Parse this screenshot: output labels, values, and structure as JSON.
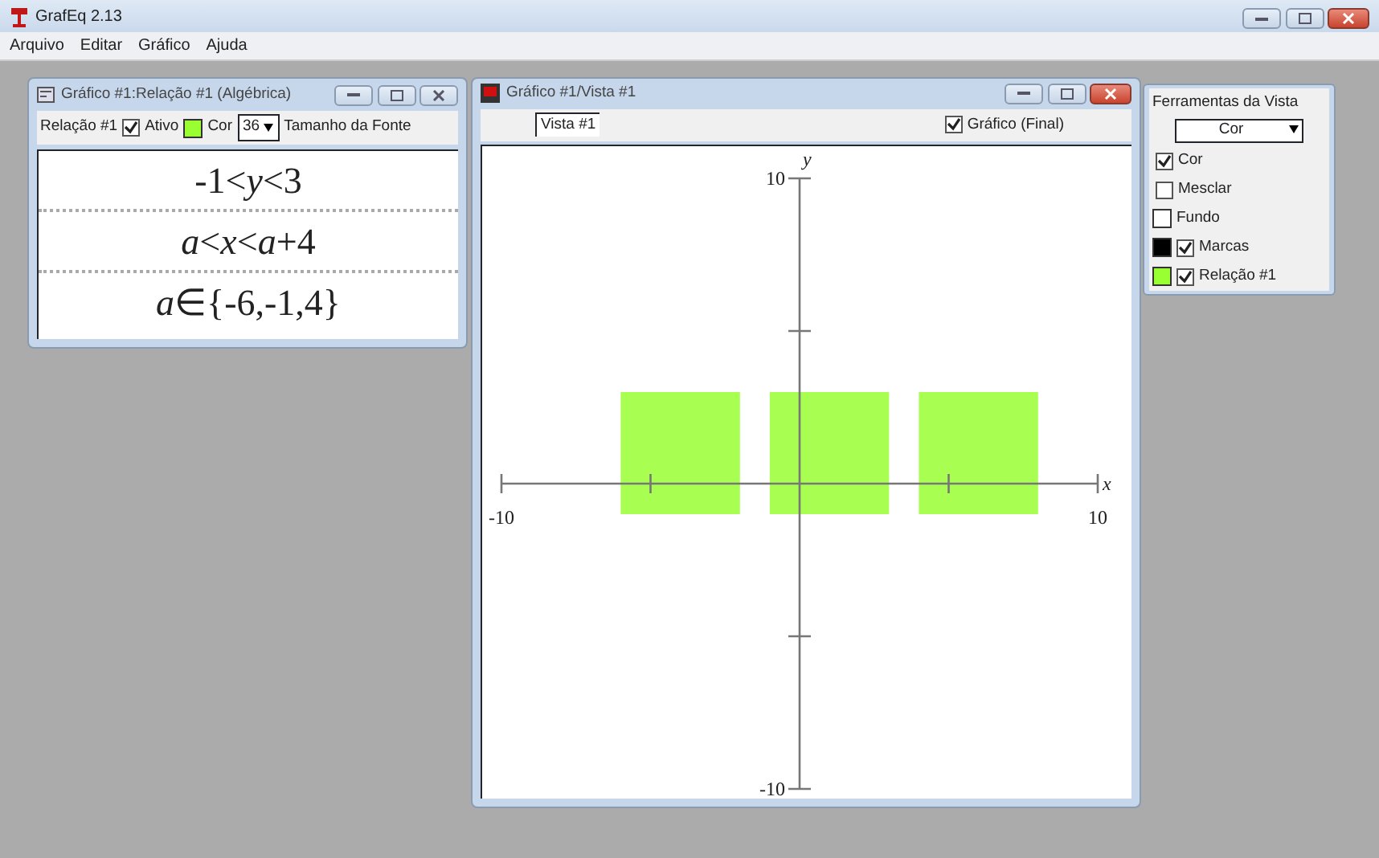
{
  "app": {
    "title": "GrafEq 2.13"
  },
  "menu": [
    "Arquivo",
    "Editar",
    "Gráfico",
    "Ajuda"
  ],
  "relation_window": {
    "title": "Gráfico #1:Relação #1 (Algébrica)",
    "relation_label": "Relação #1",
    "active": {
      "label": "Ativo",
      "checked": true
    },
    "color_label": "Cor",
    "color": "#99ff33",
    "font_size": "36",
    "font_size_label": "Tamanho da Fonte",
    "equations": [
      "-1<*y*<3",
      "*a*<*x*<*a*+4",
      "*a*∈{-6,-1,4}"
    ]
  },
  "view_window": {
    "title": "Gráfico #1/Vista #1",
    "view_name": "Vista #1",
    "final_graph": {
      "label": "Gráfico (Final)",
      "checked": true
    },
    "graph": {
      "x_axis_label": "x",
      "y_axis_label": "y",
      "x_min_label": "-10",
      "x_max_label": "10",
      "y_max_label": "10",
      "y_min_label": "-10"
    }
  },
  "tools": {
    "title": "Ferramentas da Vista",
    "mode": "Cor",
    "items": [
      {
        "kind": "check",
        "label": "Cor",
        "checked": true
      },
      {
        "kind": "check",
        "label": "Mesclar",
        "checked": false
      },
      {
        "kind": "swatch",
        "label": "Fundo",
        "color": "#ffffff"
      },
      {
        "kind": "swatch_check",
        "label": "Marcas",
        "color": "#000000",
        "checked": true
      },
      {
        "kind": "swatch_check",
        "label": "Relação #1",
        "color": "#99ff33",
        "checked": true
      }
    ]
  }
}
